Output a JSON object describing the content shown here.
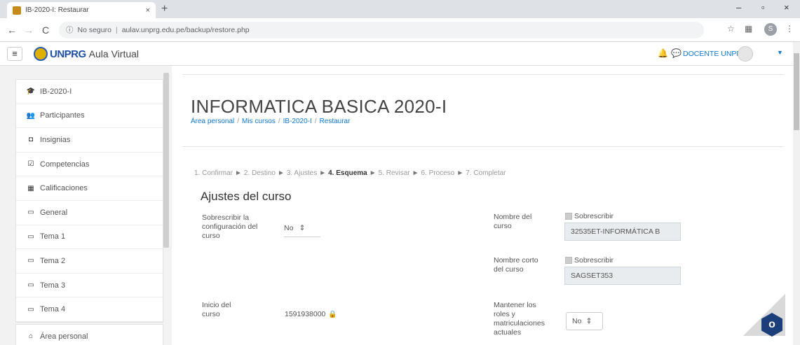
{
  "browser": {
    "tab_title": "IB-2020-I: Restaurar",
    "tab_close": "×",
    "new_tab": "+",
    "url_security": "No seguro",
    "url": "aulav.unprg.edu.pe/backup/restore.php",
    "win_minimize": "–",
    "win_restore": "▫",
    "win_close": "×"
  },
  "navbar": {
    "menu_icon": "≡",
    "brand": "UNPRG",
    "site_name": "Aula Virtual",
    "username": "DOCENTE UNPRG"
  },
  "sidebar": {
    "items": [
      {
        "icon": "graduation-cap-icon",
        "glyph": "🎓",
        "label": "IB-2020-I"
      },
      {
        "icon": "users-icon",
        "glyph": "👥",
        "label": "Participantes"
      },
      {
        "icon": "badge-icon",
        "glyph": "◘",
        "label": "Insignias"
      },
      {
        "icon": "check-square-icon",
        "glyph": "☑",
        "label": "Competencias"
      },
      {
        "icon": "grid-icon",
        "glyph": "▦",
        "label": "Calificaciones"
      },
      {
        "icon": "folder-icon",
        "glyph": "▭",
        "label": "General"
      },
      {
        "icon": "folder-icon",
        "glyph": "▭",
        "label": "Tema 1"
      },
      {
        "icon": "folder-icon",
        "glyph": "▭",
        "label": "Tema 2"
      },
      {
        "icon": "folder-icon",
        "glyph": "▭",
        "label": "Tema 3"
      },
      {
        "icon": "folder-icon",
        "glyph": "▭",
        "label": "Tema 4"
      }
    ],
    "dashboard": {
      "icon": "dashboard-icon",
      "glyph": "⌂",
      "label": "Área personal"
    }
  },
  "main": {
    "course_title": "INFORMATICA BASICA 2020-I",
    "breadcrumb": [
      "Área personal",
      "Mis cursos",
      "IB-2020-I",
      "Restaurar"
    ],
    "steps": [
      "1. Confirmar",
      "2. Destino",
      "3. Ajustes",
      "4. Esquema",
      "5. Revisar",
      "6. Proceso",
      "7. Completar"
    ],
    "current_step": "4. Esquema",
    "section_title": "Ajustes del curso",
    "overwrite_config": {
      "label": "Sobrescribir la configuración del curso",
      "value": "No"
    },
    "course_name": {
      "label": "Nombre del curso",
      "checkbox_label": "Sobrescribir",
      "value": "32535ET-INFORMÁTICA B"
    },
    "short_name": {
      "label": "Nombre corto del curso",
      "checkbox_label": "Sobrescribir",
      "value": "SAGSET353"
    },
    "course_start": {
      "label": "Inicio del curso",
      "value": "1591938000"
    },
    "keep_roles": {
      "label": "Mantener los roles y matriculaciones actuales",
      "value": "No"
    }
  },
  "colors": {
    "link": "#1177d1",
    "brand_blue": "#1e50a2",
    "help_button": "#1b3f7a"
  }
}
